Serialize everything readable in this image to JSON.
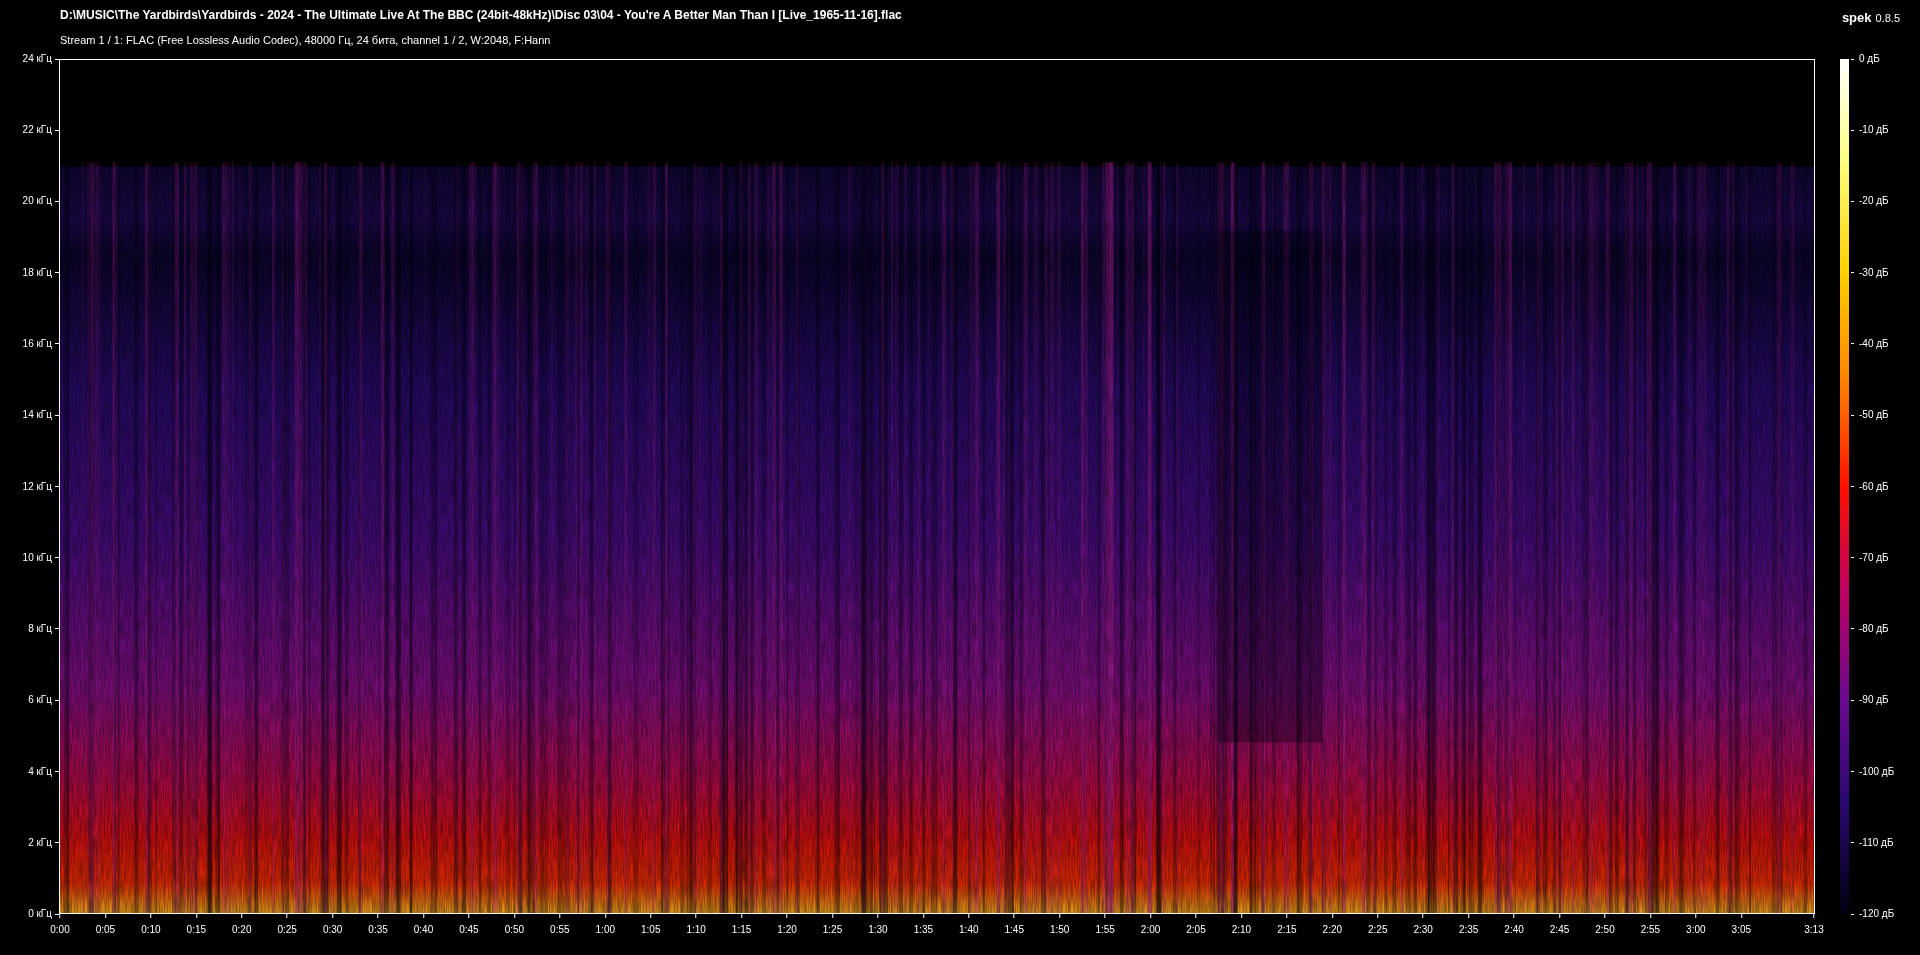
{
  "title": "D:\\MUSIC\\The Yardbirds\\Yardbirds - 2024 - The Ultimate Live At The BBC (24bit-48kHz)\\Disc 03\\04 - You're A Better Man Than I [Live_1965-11-16].flac",
  "subtitle": "Stream 1 / 1: FLAC (Free Lossless Audio Codec), 48000 Гц, 24 бита, channel 1 / 2, W:2048, F:Hann",
  "app": {
    "name": "spek",
    "version": "0.8.5"
  },
  "frequency_axis": [
    "24 кГц",
    "22 кГц",
    "20 кГц",
    "18 кГц",
    "16 кГц",
    "14 кГц",
    "12 кГц",
    "10 кГц",
    "8 кГц",
    "6 кГц",
    "4 кГц",
    "2 кГц",
    "0 кГц"
  ],
  "time_axis": [
    {
      "label": "0:00",
      "kind": "regular"
    },
    {
      "label": "0:05",
      "kind": "regular"
    },
    {
      "label": "0:10",
      "kind": "regular"
    },
    {
      "label": "0:15",
      "kind": "regular"
    },
    {
      "label": "0:20",
      "kind": "regular"
    },
    {
      "label": "0:25",
      "kind": "regular"
    },
    {
      "label": "0:30",
      "kind": "regular"
    },
    {
      "label": "0:35",
      "kind": "regular"
    },
    {
      "label": "0:40",
      "kind": "regular"
    },
    {
      "label": "0:45",
      "kind": "regular"
    },
    {
      "label": "0:50",
      "kind": "regular"
    },
    {
      "label": "0:55",
      "kind": "regular"
    },
    {
      "label": "1:00",
      "kind": "regular"
    },
    {
      "label": "1:05",
      "kind": "regular"
    },
    {
      "label": "1:10",
      "kind": "regular"
    },
    {
      "label": "1:15",
      "kind": "regular"
    },
    {
      "label": "1:20",
      "kind": "regular"
    },
    {
      "label": "1:25",
      "kind": "regular"
    },
    {
      "label": "1:30",
      "kind": "regular"
    },
    {
      "label": "1:35",
      "kind": "regular"
    },
    {
      "label": "1:40",
      "kind": "regular"
    },
    {
      "label": "1:45",
      "kind": "regular"
    },
    {
      "label": "1:50",
      "kind": "regular"
    },
    {
      "label": "1:55",
      "kind": "regular"
    },
    {
      "label": "2:00",
      "kind": "regular"
    },
    {
      "label": "2:05",
      "kind": "regular"
    },
    {
      "label": "2:10",
      "kind": "regular"
    },
    {
      "label": "2:15",
      "kind": "regular"
    },
    {
      "label": "2:20",
      "kind": "regular"
    },
    {
      "label": "2:25",
      "kind": "regular"
    },
    {
      "label": "2:30",
      "kind": "regular"
    },
    {
      "label": "2:35",
      "kind": "regular"
    },
    {
      "label": "2:40",
      "kind": "regular"
    },
    {
      "label": "2:45",
      "kind": "regular"
    },
    {
      "label": "2:50",
      "kind": "regular"
    },
    {
      "label": "2:55",
      "kind": "regular"
    },
    {
      "label": "3:00",
      "kind": "regular"
    },
    {
      "label": "3:05",
      "kind": "regular"
    },
    {
      "label": "3:13",
      "kind": "end"
    }
  ],
  "db_scale": [
    "0 дБ",
    "-10 дБ",
    "-20 дБ",
    "-30 дБ",
    "-40 дБ",
    "-50 дБ",
    "-60 дБ",
    "-70 дБ",
    "-80 дБ",
    "-90 дБ",
    "-100 дБ",
    "-110 дБ",
    "-120 дБ"
  ]
}
